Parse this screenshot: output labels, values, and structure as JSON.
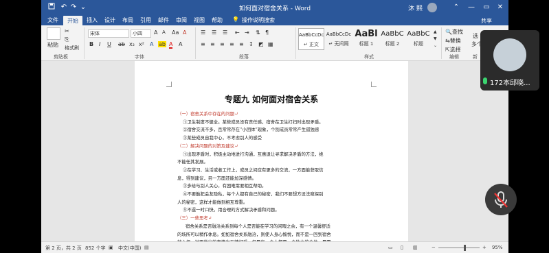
{
  "titlebar": {
    "title": "如何面对宿舍关系 - Word",
    "user": "沐 熙",
    "minimize": "—",
    "restore": "▭",
    "close": "✕",
    "ribbon_toggle": "⌃"
  },
  "tabs": [
    "文件",
    "开始",
    "插入",
    "设计",
    "布局",
    "引用",
    "邮件",
    "审阅",
    "视图",
    "帮助"
  ],
  "active_tab": "开始",
  "tell_me": "操作说明搜索",
  "share": "共享",
  "ribbon": {
    "clipboard": {
      "paste": "粘贴",
      "format_painter": "格式刷",
      "label": "剪贴板"
    },
    "font": {
      "name": "宋体",
      "size": "小四",
      "label": "字体",
      "bold": "B",
      "italic": "I",
      "underline": "U",
      "grow": "A",
      "clear": "A"
    },
    "paragraph": {
      "label": "段落"
    },
    "styles": {
      "label": "样式",
      "items": [
        {
          "sample": "AaBbCcDc",
          "name": "↵ 正文"
        },
        {
          "sample": "AaBbCcDc",
          "name": "↵ 无间隔"
        },
        {
          "sample": "AaBl",
          "name": "标题 1"
        },
        {
          "sample": "AaBbC",
          "name": "标题 2"
        },
        {
          "sample": "AaBbC",
          "name": "标题"
        }
      ]
    },
    "editing": {
      "find": "查找",
      "replace": "替换",
      "select": "选择",
      "label": "编辑"
    },
    "extra": [
      "选",
      "多个"
    ],
    "extra_label": "新"
  },
  "document": {
    "title": "专题九  如何面对宿舍关系",
    "lines": [
      {
        "text": "（一）宿舍关系中存在的问题↵",
        "heading": true
      },
      {
        "text": "①卫生制度不健全。某些成员没有责任感，宿舍在卫生打扫时出现矛盾。",
        "heading": false
      },
      {
        "text": "②宿舍交流不多，且常常存在“小团体”现象，个别成员常常产生孤独感",
        "heading": false
      },
      {
        "text": "③某些成员自我中心，不考虑别人的感受",
        "heading": false
      },
      {
        "text": "（二）解决问题的对策及建议↵",
        "heading": true
      },
      {
        "text": "①出现矛盾时，积极主动地进行沟通，互惠退让寻求解决矛盾的方法，绝",
        "heading": false
      },
      {
        "text": "不能任其发展。",
        "heading": false
      },
      {
        "text": "②在学习、生活或者工作上，成员之间应有更多的交流，一方面能获取信",
        "heading": false
      },
      {
        "text": "息，得到建议，另一方面还能加深感情。",
        "heading": false
      },
      {
        "text": "③多给与别人关心，有困难需要相互帮助。",
        "heading": false
      },
      {
        "text": "④不要触犯会友隐私，每个人都有自己的秘密，我们不要想方设法窥探别",
        "heading": false
      },
      {
        "text": "人的秘密，这样才能做到相互尊重。",
        "heading": false
      },
      {
        "text": "⑤不逞一时口快，用合理的方式解决矛盾和问题。",
        "heading": false
      },
      {
        "text": "（三）一些思考↵",
        "heading": true
      },
      {
        "text": "宿舍关系是否融洽关系到每个人是否能在学习的闲暇之余，有一个温馨舒适",
        "heading": false
      },
      {
        "text": "的场所可以稍作休息。如如宿舍关系融洽，则使人身心愉悦，而不是一回到宿舍",
        "heading": false
      },
      {
        "text": "就心烦，进而做出的事情也无精打采，但是每一个人都是一个独立的个体，是需",
        "heading": false
      }
    ]
  },
  "status": {
    "page": "第 2 页，共 2 页",
    "words": "852 个字",
    "lang": "中文(中国)",
    "zoom": "95%",
    "zoom_minus": "−",
    "zoom_plus": "+"
  },
  "camera": {
    "name": "172本邱晓..."
  }
}
